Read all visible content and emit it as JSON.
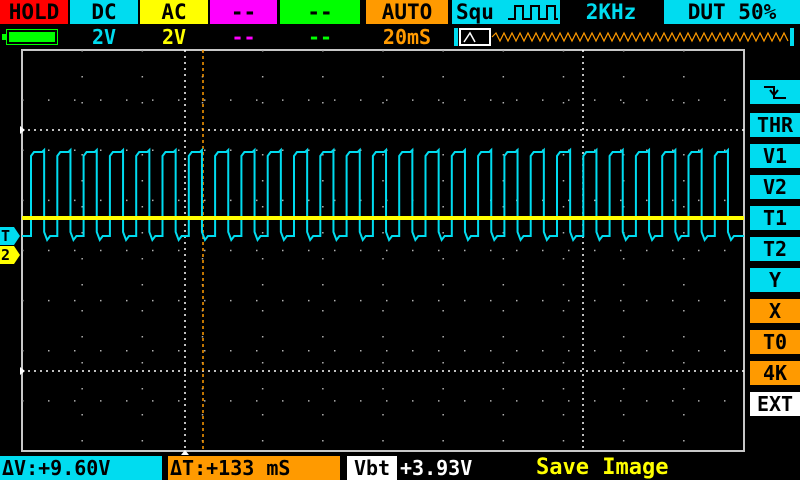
{
  "colors": {
    "ch1": "#00dcf0",
    "ch2": "#ffff00",
    "ch3": "#ff00ff",
    "ch4": "#00ff00",
    "orange": "#ff9a00",
    "red": "#ff0000",
    "grid": "#b0b0b0",
    "frame": "#c8c8c8"
  },
  "top_bar": {
    "hold": "HOLD",
    "ch1_coupling": "DC",
    "ch2_coupling": "AC",
    "ch3_coupling": "--",
    "ch4_coupling": "--",
    "trigger_mode": "AUTO",
    "wave_type": "Squ",
    "frequency": "2KHz",
    "duty": "DUT 50%"
  },
  "second_bar": {
    "battery_level": 1.0,
    "ch1_scale": "2V",
    "ch2_scale": "2V",
    "ch3_scale": "--",
    "ch4_scale": "--",
    "timebase": "20mS"
  },
  "markers": {
    "trigger_label": "T",
    "ch2_label": "2"
  },
  "right_menu": {
    "trigger_edge_icon": "falling-edge-icon",
    "items": [
      "THR",
      "V1",
      "V2",
      "T1",
      "T2",
      "Y",
      "X",
      "T0",
      "4K",
      "EXT"
    ]
  },
  "bottom_bar": {
    "delta_v": "ΔV:+9.60V",
    "delta_t": "ΔT:+133 mS",
    "vbt_label": "Vbt",
    "vbt_value": "+3.93V",
    "status": "Save Image"
  },
  "waveform": {
    "ch1_shape": "square",
    "ch1_duty": 0.5,
    "ch1_cycles_visible": 27,
    "ch2_shape": "flat"
  }
}
